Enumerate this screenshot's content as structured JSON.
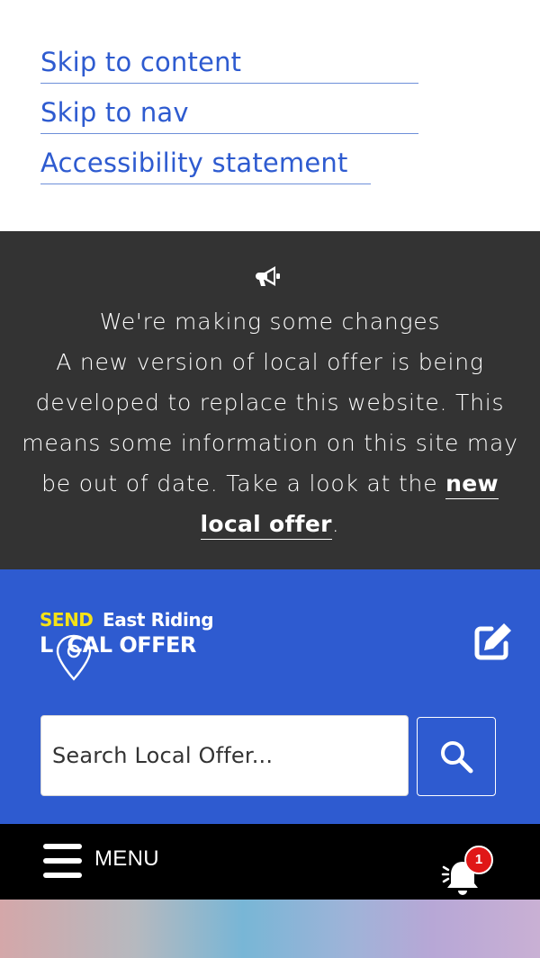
{
  "skip_links": {
    "content": "Skip to content",
    "nav": "Skip to nav",
    "accessibility": "Accessibility statement"
  },
  "announcement": {
    "icon": "megaphone-icon",
    "title": "We're making some changes",
    "body": "A new version of local offer is being developed to replace this website. This means some information on this site may be out of date. Take a look at the",
    "link_text": "new local offer",
    "suffix": "."
  },
  "header": {
    "logo": {
      "send": "SEND",
      "east_riding": "East Riding",
      "local_offer": "L  CAL OFFER"
    },
    "edit_icon": "edit-icon",
    "search": {
      "placeholder": "Search Local Offer...",
      "button_icon": "search-icon"
    }
  },
  "menubar": {
    "menu_label": "MENU",
    "notification_count": "1",
    "notification_icon": "bell-icon"
  },
  "colors": {
    "brand_blue": "#2e5bd0",
    "dark_banner": "#333333",
    "logo_yellow": "#f5e216",
    "badge_red": "#e01717"
  }
}
